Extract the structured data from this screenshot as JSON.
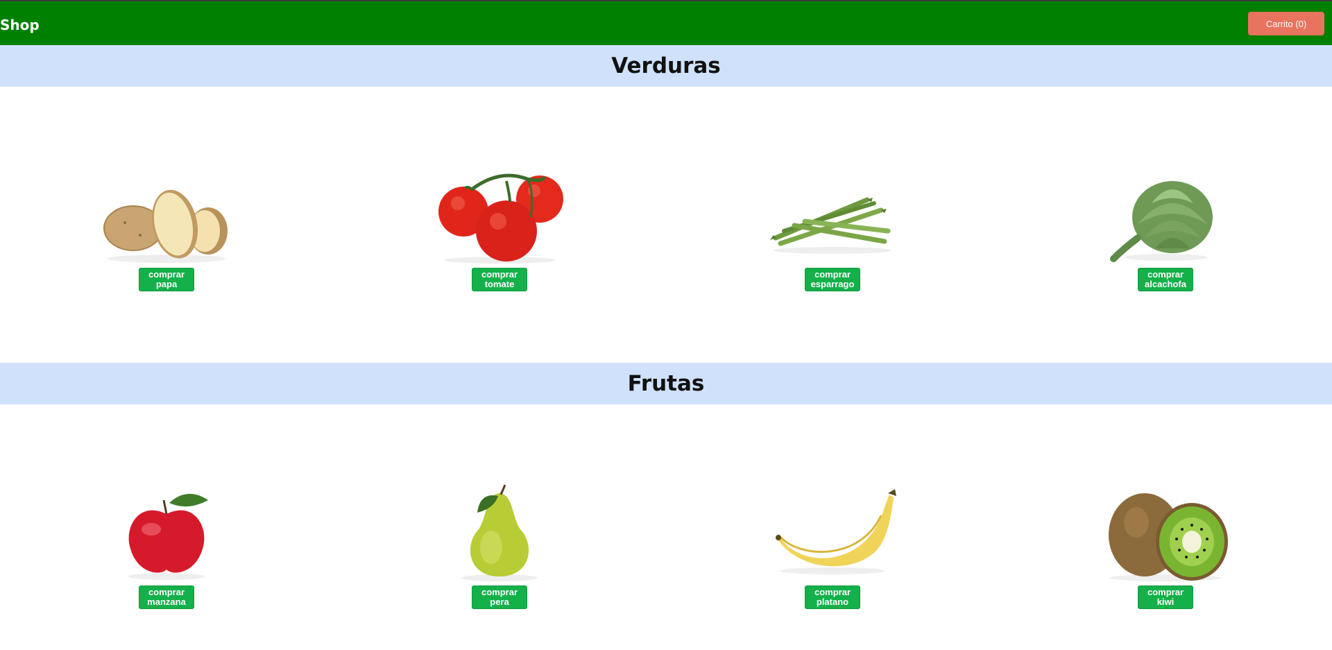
{
  "navbar": {
    "brand": "Shop",
    "cart_label": "Carrito (0)",
    "bg_color": "#008000",
    "cart_color": "#e8735e"
  },
  "sections": [
    {
      "title": "Verduras",
      "products": [
        {
          "action": "comprar",
          "name": "papa",
          "icon": "potato-image"
        },
        {
          "action": "comprar",
          "name": "tomate",
          "icon": "tomato-image"
        },
        {
          "action": "comprar",
          "name": "esparrago",
          "icon": "asparagus-image"
        },
        {
          "action": "comprar",
          "name": "alcachofa",
          "icon": "artichoke-image"
        }
      ]
    },
    {
      "title": "Frutas",
      "products": [
        {
          "action": "comprar",
          "name": "manzana",
          "icon": "apple-image"
        },
        {
          "action": "comprar",
          "name": "pera",
          "icon": "pear-image"
        },
        {
          "action": "comprar",
          "name": "platano",
          "icon": "banana-image"
        },
        {
          "action": "comprar",
          "name": "kiwi",
          "icon": "kiwi-image"
        }
      ]
    }
  ],
  "colors": {
    "section_header_bg": "#d0e1fc",
    "buy_button": "#14b04a"
  }
}
